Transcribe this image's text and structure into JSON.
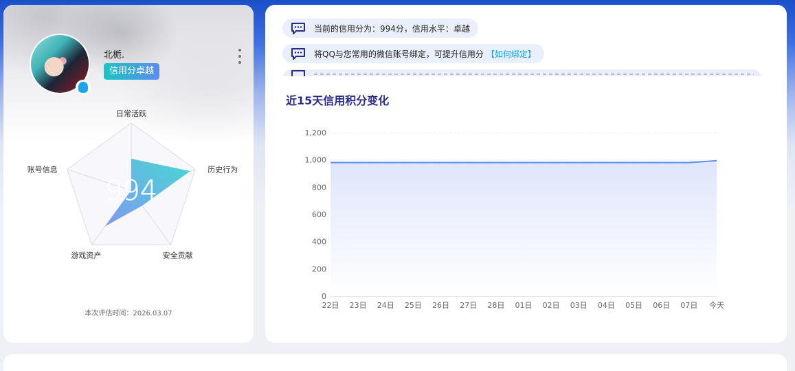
{
  "profile": {
    "username": "北栀.",
    "level_badge": "信用分卓越",
    "avatar_icon": "avatar-image",
    "platform_icon": "qq-penguin-icon"
  },
  "radar": {
    "score": "994",
    "axes": [
      "日常活跃",
      "历史行为",
      "安全贡献",
      "游戏资产",
      "账号信息"
    ],
    "values": [
      0.47,
      0.92,
      0.28,
      0.66,
      0.0
    ],
    "eval_time": "本次评估时间：2026.03.07"
  },
  "notices": [
    {
      "text": "当前的信用分为：994分，信用水平：卓越",
      "link": ""
    },
    {
      "text": "将QQ与您常用的微信账号绑定，可提升信用分",
      "link": "【如何绑定】"
    }
  ],
  "chart_data": {
    "type": "area",
    "title": "近15天信用积分变化",
    "categories": [
      "22日",
      "23日",
      "24日",
      "25日",
      "26日",
      "27日",
      "28日",
      "01日",
      "02日",
      "03日",
      "04日",
      "05日",
      "06日",
      "07日",
      "今天"
    ],
    "values": [
      980,
      980,
      980,
      980,
      980,
      980,
      980,
      980,
      980,
      980,
      980,
      980,
      980,
      980,
      994
    ],
    "yticks": [
      "0",
      "200",
      "400",
      "600",
      "800",
      "1,000",
      "1,200"
    ],
    "ylim": [
      0,
      1200
    ],
    "xlabel": "",
    "ylabel": "",
    "grid": true,
    "line_color": "#5b8ff0",
    "fill_color": "#dfe6fb"
  },
  "colors": {
    "accent": "#2a2a85",
    "badge_start": "#19c5c0",
    "badge_end": "#5a8cf0",
    "notice_bg": "#e9effb",
    "link": "#1aa0e6"
  }
}
